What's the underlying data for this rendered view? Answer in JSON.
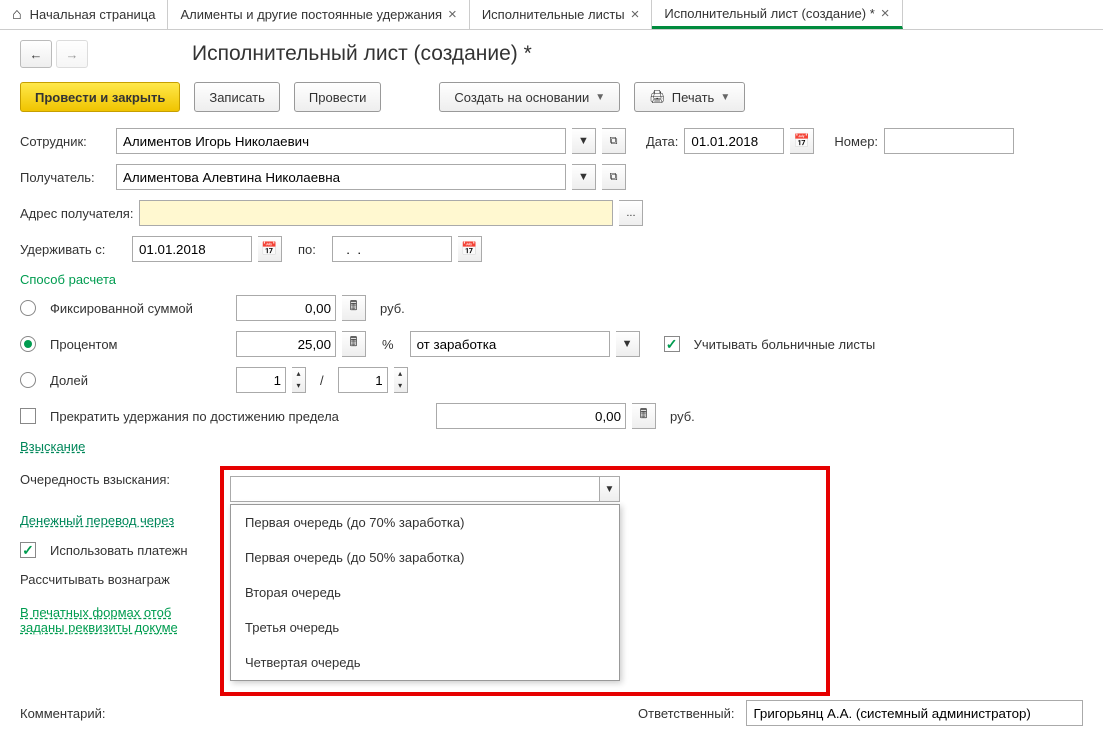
{
  "tabs": {
    "home": "Начальная страница",
    "t1": "Алименты и другие постоянные удержания",
    "t2": "Исполнительные листы",
    "t3": "Исполнительный лист (создание) *"
  },
  "title": "Исполнительный лист (создание) *",
  "toolbar": {
    "post_close": "Провести и закрыть",
    "save": "Записать",
    "post": "Провести",
    "create_based": "Создать на основании",
    "print": "Печать"
  },
  "labels": {
    "employee": "Сотрудник:",
    "date": "Дата:",
    "number": "Номер:",
    "receiver": "Получатель:",
    "address": "Адрес получателя:",
    "withhold_from": "Удерживать с:",
    "to": "по:",
    "calc_method": "Способ расчета",
    "fixed": "Фиксированной суммой",
    "percent": "Процентом",
    "fraction": "Долей",
    "rub": "руб.",
    "pct": "%",
    "from_earn": "от заработка",
    "sick_leave": "Учитывать больничные листы",
    "stop_limit": "Прекратить удержания по достижению предела",
    "recovery": "Взыскание",
    "priority": "Очередность взыскания:",
    "transfer": "Денежный перевод через",
    "use_agent": "Использовать платежн",
    "calc_reward": "Рассчитывать вознаграж",
    "print_forms": "В печатных формах отоб",
    "doc_reqs": "заданы реквизиты докуме",
    "comment": "Комментарий:",
    "responsible": "Ответственный:"
  },
  "values": {
    "employee": "Алиментов Игорь Николаевич",
    "date": "01.01.2018",
    "number": "",
    "receiver": "Алиментова Алевтина Николаевна",
    "address": "",
    "withhold_from": "01.01.2018",
    "withhold_to": "  .  .    ",
    "fixed_amount": "0,00",
    "percent_val": "25,00",
    "frac_num": "1",
    "frac_den": "1",
    "limit_amount": "0,00",
    "priority": "",
    "responsible": "Григорьянц А.А. (системный администратор)"
  },
  "dropdown_options": [
    "Первая очередь (до 70% заработка)",
    "Первая очередь (до 50% заработка)",
    "Вторая очередь",
    "Третья очередь",
    "Четвертая очередь"
  ]
}
